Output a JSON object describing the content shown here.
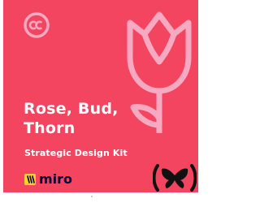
{
  "cover": {
    "title_lines": [
      "Rose, Bud,",
      "Thorn"
    ],
    "subtitle": "Strategic Design Kit",
    "miro_wordmark": "miro",
    "background_color": "#f34560",
    "accent_color": "#f7a9c2"
  },
  "icons": {
    "license": "creative-commons-icon",
    "flower": "rose-icon",
    "brand_mark": "butterfly-icon",
    "miro_logo": "miro-logo"
  }
}
